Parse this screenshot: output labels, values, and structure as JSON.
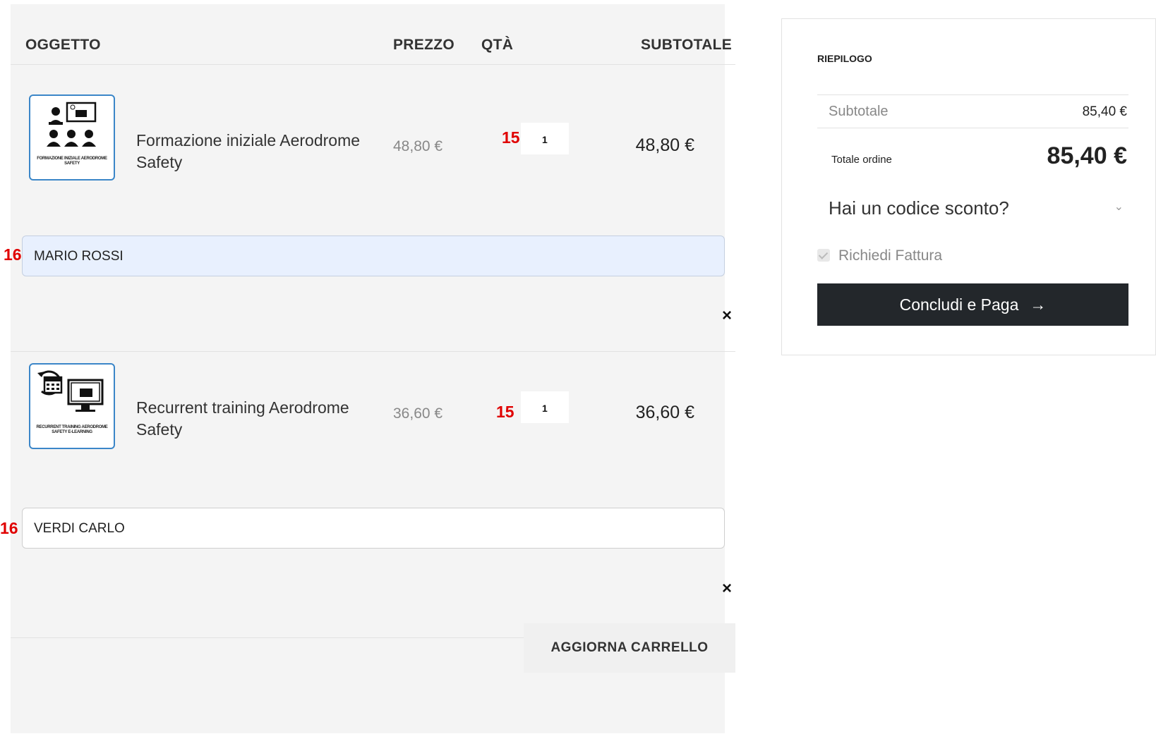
{
  "table_header": {
    "item": "OGGETTO",
    "price": "PREZZO",
    "qty": "QTÀ",
    "subtotal": "SUBTOTALE"
  },
  "items": [
    {
      "name": "Formazione iniziale Aerodrome Safety",
      "price": "48,80 €",
      "qty_marker": "15",
      "qty": "1",
      "subtotal": "48,80 €",
      "attendee_marker": "16",
      "attendee": "MARIO ROSSI",
      "remove": "×",
      "thumb_caption": "FORMAZIONE INIZIALE AERODROME SAFETY",
      "thumb_icon": "classroom-icon"
    },
    {
      "name": "Recurrent training Aerodrome Safety",
      "price": "36,60 €",
      "qty_marker": "15",
      "qty": "1",
      "subtotal": "36,60 €",
      "attendee_marker": "16",
      "attendee": "VERDI CARLO",
      "remove": "×",
      "thumb_caption": "RECURRENT TRAINING AERODROME SAFETY E-LEARNING",
      "thumb_icon": "elearning-icon"
    }
  ],
  "update_cart": "AGGIORNA CARRELLO",
  "summary": {
    "title": "RIEPILOGO",
    "subtotal_label": "Subtotale",
    "subtotal_value": "85,40 €",
    "total_label": "Totale ordine",
    "total_value": "85,40 €",
    "discount_label": "Hai un codice sconto?",
    "invoice_label": "Richiedi Fattura",
    "pay_button": "Concludi e Paga",
    "pay_arrow": "→"
  },
  "colors": {
    "marker": "#e00000",
    "thumb_border": "#3b86c8",
    "pay_button": "#23272b"
  }
}
